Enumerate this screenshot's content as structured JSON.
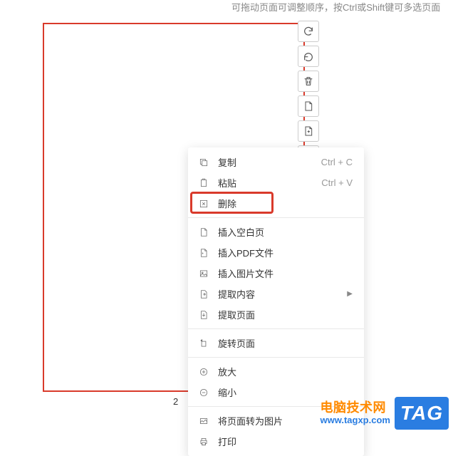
{
  "hint": "可拖动页面可调整顺序，按Ctrl或Shift键可多选页面",
  "page_number": "2",
  "toolbar": {
    "rotate_right": "rotate",
    "undo": "undo",
    "delete": "delete",
    "insert_page": "insert",
    "insert_after": "insert-after"
  },
  "menu": {
    "copy": {
      "label": "复制",
      "shortcut": "Ctrl + C"
    },
    "paste": {
      "label": "粘贴",
      "shortcut": "Ctrl + V"
    },
    "delete": {
      "label": "删除"
    },
    "insert_blank": {
      "label": "插入空白页"
    },
    "insert_pdf": {
      "label": "插入PDF文件"
    },
    "insert_image": {
      "label": "插入图片文件"
    },
    "extract_content": {
      "label": "提取内容"
    },
    "extract_page": {
      "label": "提取页面"
    },
    "rotate_page": {
      "label": "旋转页面"
    },
    "zoom_in": {
      "label": "放大"
    },
    "zoom_out": {
      "label": "缩小"
    },
    "convert_image": {
      "label": "将页面转为图片"
    },
    "print": {
      "label": "打印"
    }
  },
  "watermark": {
    "line1": "电脑技术网",
    "line2": "www.tagxp.com",
    "badge": "TAG"
  }
}
